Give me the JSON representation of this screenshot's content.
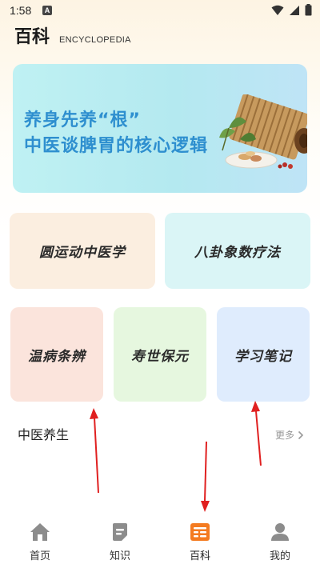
{
  "status": {
    "time": "1:58",
    "notif_letter": "A"
  },
  "header": {
    "title": "百科",
    "subtitle": "ENCYCLOPEDIA"
  },
  "banner": {
    "line1": "养身先养“根”",
    "line2": "中医谈脾胃的核心逻辑"
  },
  "cards": [
    "圆运动中医学",
    "八卦象数疗法",
    "温病条辨",
    "寿世保元",
    "学习笔记"
  ],
  "section": {
    "title": "中医养生",
    "more": "更多"
  },
  "tabs": [
    {
      "label": "首页",
      "icon": "home-icon"
    },
    {
      "label": "知识",
      "icon": "note-icon"
    },
    {
      "label": "百科",
      "icon": "encyclopedia-icon",
      "active": true
    },
    {
      "label": "我的",
      "icon": "person-icon"
    }
  ],
  "colors": {
    "accent": "#f47b20",
    "banner_text": "#2e8fcf",
    "arrow": "#e02020"
  }
}
